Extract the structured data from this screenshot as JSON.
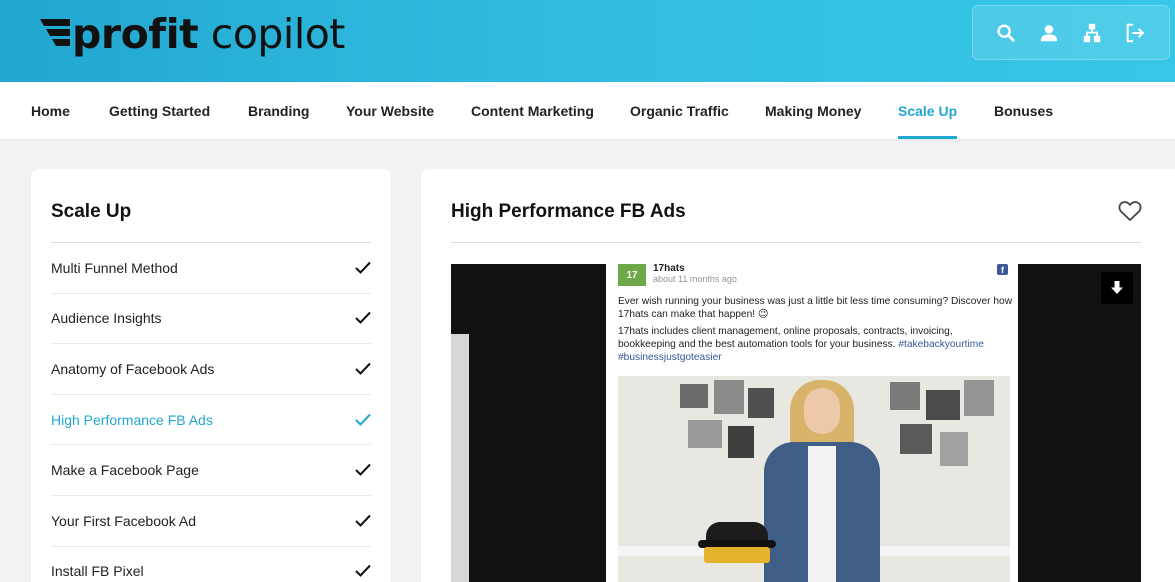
{
  "app": {
    "logo_bold": "profit",
    "logo_light": "copilot",
    "accent_color": "#22a7d0"
  },
  "header_tools": [
    {
      "name": "search-icon"
    },
    {
      "name": "user-icon"
    },
    {
      "name": "sitemap-icon"
    },
    {
      "name": "logout-icon"
    }
  ],
  "nav": {
    "items": [
      {
        "label": "Home",
        "active": false
      },
      {
        "label": "Getting Started",
        "active": false
      },
      {
        "label": "Branding",
        "active": false
      },
      {
        "label": "Your Website",
        "active": false
      },
      {
        "label": "Content Marketing",
        "active": false
      },
      {
        "label": "Organic Traffic",
        "active": false
      },
      {
        "label": "Making Money",
        "active": false
      },
      {
        "label": "Scale Up",
        "active": true
      },
      {
        "label": "Bonuses",
        "active": false
      }
    ]
  },
  "sidebar": {
    "title": "Scale Up",
    "lessons": [
      {
        "label": "Multi Funnel Method",
        "completed": true,
        "active": false
      },
      {
        "label": "Audience Insights",
        "completed": true,
        "active": false
      },
      {
        "label": "Anatomy of Facebook Ads",
        "completed": true,
        "active": false
      },
      {
        "label": "High Performance FB Ads",
        "completed": true,
        "active": true
      },
      {
        "label": "Make a Facebook Page",
        "completed": true,
        "active": false
      },
      {
        "label": "Your First Facebook Ad",
        "completed": true,
        "active": false
      },
      {
        "label": "Install FB Pixel",
        "completed": true,
        "active": false
      }
    ]
  },
  "main": {
    "title": "High Performance FB Ads",
    "video": {
      "post": {
        "logo_text": "17",
        "page_name": "17hats",
        "timestamp": "about 11 months ago",
        "fb_badge": "f",
        "text_line1": "Ever wish running your business was just a little bit less time consuming? Discover how 17hats can make that happen! 😉",
        "text_line2": "17hats includes client management, online proposals, contracts, invoicing, bookkeeping and the best automation tools for your business.",
        "hashtag1": "#takebackyourtime",
        "hashtag2": "#businessjustgoteasier"
      }
    }
  }
}
